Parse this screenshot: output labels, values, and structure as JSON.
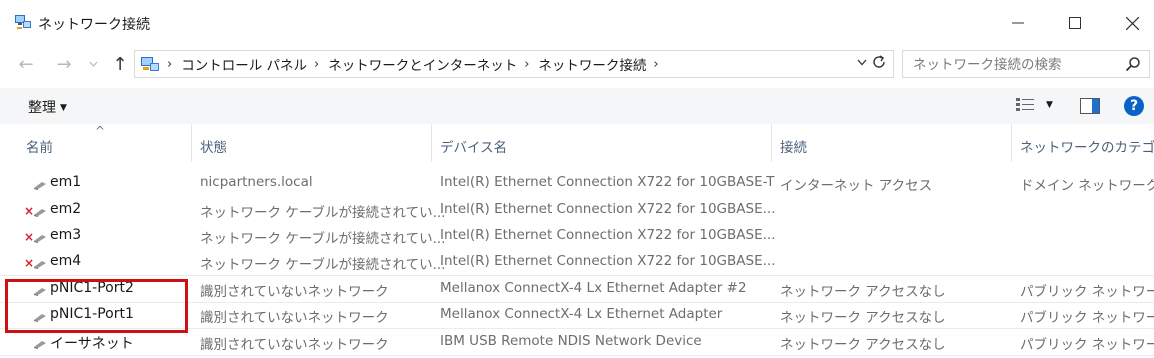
{
  "window": {
    "title": "ネットワーク接続"
  },
  "address": {
    "crumbs": [
      "コントロール パネル",
      "ネットワークとインターネット",
      "ネットワーク接続"
    ],
    "search_placeholder": "ネットワーク接続の検索"
  },
  "toolbar": {
    "organize_label": "整理"
  },
  "columns": {
    "name": "名前",
    "status": "状態",
    "device": "デバイス名",
    "connectivity": "接続",
    "category": "ネットワークのカテゴリ"
  },
  "rows": [
    {
      "name": "em1",
      "status": "nicpartners.local",
      "device": "Intel(R) Ethernet Connection X722 for 10GBASE-T",
      "connectivity": "インターネット アクセス",
      "category": "ドメイン ネットワーク",
      "disconnected": false
    },
    {
      "name": "em2",
      "status": "ネットワーク ケーブルが接続されてい...",
      "device": "Intel(R) Ethernet Connection X722 for 10GBASE...",
      "connectivity": "",
      "category": "",
      "disconnected": true
    },
    {
      "name": "em3",
      "status": "ネットワーク ケーブルが接続されてい...",
      "device": "Intel(R) Ethernet Connection X722 for 10GBASE...",
      "connectivity": "",
      "category": "",
      "disconnected": true
    },
    {
      "name": "em4",
      "status": "ネットワーク ケーブルが接続されてい...",
      "device": "Intel(R) Ethernet Connection X722 for 10GBASE...",
      "connectivity": "",
      "category": "",
      "disconnected": true
    },
    {
      "name": "pNIC1-Port2",
      "status": "識別されていないネットワーク",
      "device": "Mellanox ConnectX-4 Lx Ethernet Adapter #2",
      "connectivity": "ネットワーク アクセスなし",
      "category": "パブリック ネットワーク",
      "disconnected": false
    },
    {
      "name": "pNIC1-Port1",
      "status": "識別されていないネットワーク",
      "device": "Mellanox ConnectX-4 Lx Ethernet Adapter",
      "connectivity": "ネットワーク アクセスなし",
      "category": "パブリック ネットワーク",
      "disconnected": false
    },
    {
      "name": "イーサネット",
      "status": "識別されていないネットワーク",
      "device": "IBM USB Remote NDIS Network Device",
      "connectivity": "ネットワーク アクセスなし",
      "category": "パブリック ネットワーク",
      "disconnected": false
    }
  ],
  "colors": {
    "help_blue": "#0a62c9",
    "highlight_red": "#d01010",
    "header_text": "#4c607a"
  }
}
